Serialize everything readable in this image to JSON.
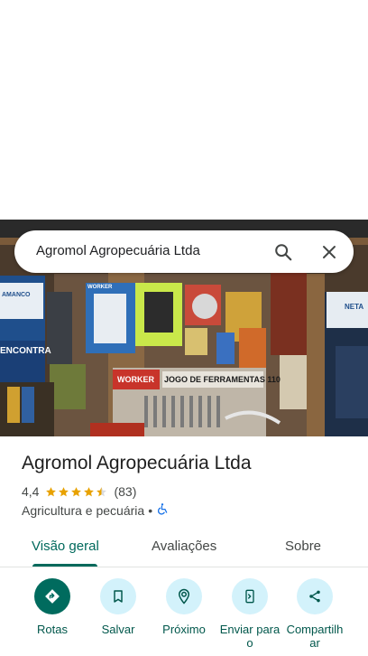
{
  "search": {
    "query": "Agromol Agropecuária Ltda"
  },
  "photo": {
    "signs": {
      "amanco": "AMANCO",
      "encontra": "ENCONTRA",
      "worker1": "WORKER",
      "worker2": "WORKER",
      "jogo": "JOGO DE FERRAMENTAS 110",
      "neta": "NETA"
    }
  },
  "place": {
    "name": "Agromol Agropecuária Ltda",
    "rating": "4,4",
    "stars": 4.4,
    "reviews": "(83)",
    "category": "Agricultura e pecuária",
    "separator": "•"
  },
  "tabs": [
    {
      "label": "Visão geral"
    },
    {
      "label": "Avaliações"
    },
    {
      "label": "Sobre"
    }
  ],
  "actions": [
    {
      "label": "Rotas",
      "icon": "directions-icon"
    },
    {
      "label": "Salvar",
      "icon": "bookmark-icon"
    },
    {
      "label": "Próximo",
      "icon": "nearby-icon"
    },
    {
      "label": "Enviar para o",
      "icon": "send-to-phone-icon"
    },
    {
      "label": "Compartilhar",
      "icon": "share-icon"
    }
  ],
  "colors": {
    "accent": "#00695c",
    "action_bg": "#d3f2fb",
    "star": "#e8a200",
    "primary_action": "#006b5e"
  }
}
